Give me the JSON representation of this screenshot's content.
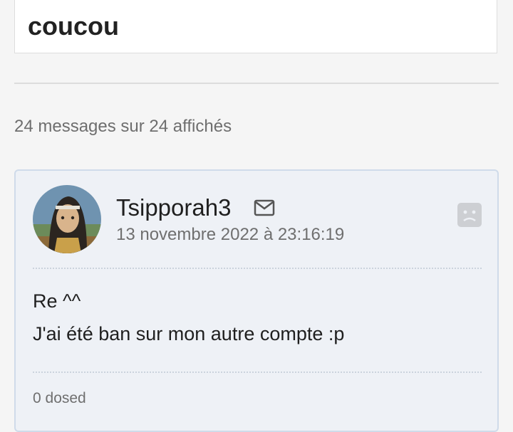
{
  "previous_post": {
    "text": "coucou"
  },
  "message_count": "24 messages sur 24 affichés",
  "post": {
    "username": "Tsipporah3",
    "date": "13 novembre 2022 à 23:16:19",
    "body_lines": [
      "Re ^^",
      "J'ai été ban sur mon autre compte :p"
    ],
    "footer": "0 dosed",
    "icons": {
      "mail": "mail-icon",
      "status": "sad-face-icon"
    }
  }
}
